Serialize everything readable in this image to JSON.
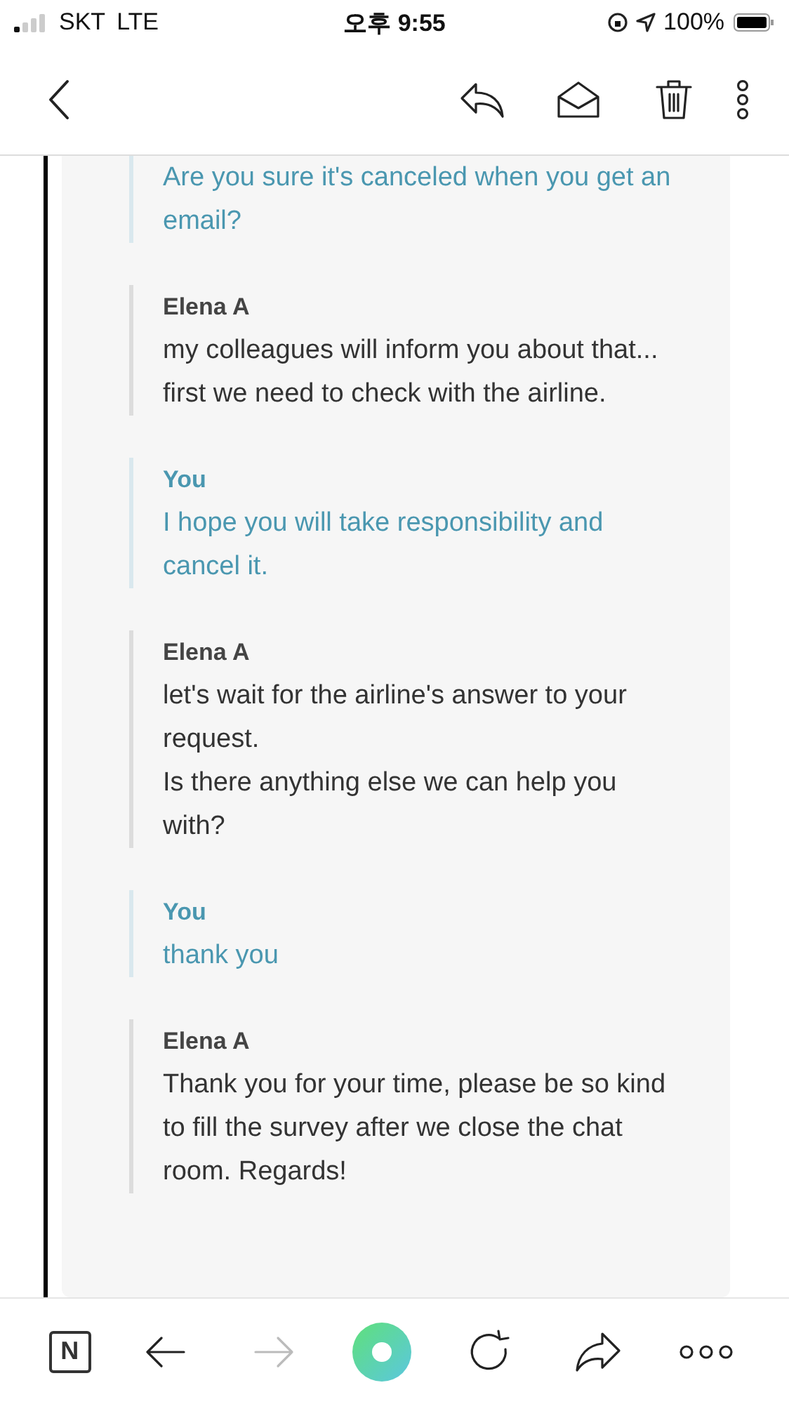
{
  "status_bar": {
    "carrier": "SKT",
    "network": "LTE",
    "time": "오후 9:55",
    "battery": "100%"
  },
  "messages": [
    {
      "kind": "user",
      "lines": [
        "Are you sure it's canceled when you get an email?"
      ]
    },
    {
      "kind": "agent",
      "author": "Elena A",
      "lines": [
        "my colleagues will inform you about that...",
        "first we need to check with the airline."
      ]
    },
    {
      "kind": "user",
      "author": "You",
      "lines": [
        "I hope you will take responsibility and cancel it."
      ]
    },
    {
      "kind": "agent",
      "author": "Elena A",
      "lines": [
        "let's wait for the airline's answer to your request.",
        "Is there anything else we can help you with?"
      ]
    },
    {
      "kind": "user",
      "author": "You",
      "lines": [
        "thank you"
      ]
    },
    {
      "kind": "agent",
      "author": "Elena A",
      "lines": [
        "Thank you for your time, please be so kind to fill the survey after we close the chat room. Regards!"
      ]
    }
  ],
  "bottom_bar": {
    "logo": "N",
    "forward_disabled": true
  }
}
